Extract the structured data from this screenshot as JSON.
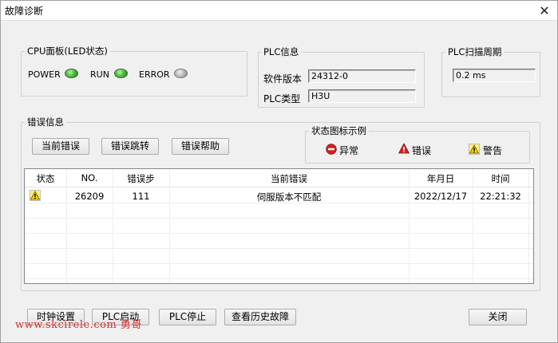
{
  "window": {
    "title": "故障诊断",
    "close_glyph": "✕"
  },
  "cpu_panel": {
    "title": "CPU面板(LED状态)",
    "leds": [
      {
        "label": "POWER",
        "state": "on"
      },
      {
        "label": "RUN",
        "state": "on"
      },
      {
        "label": "ERROR",
        "state": "off"
      }
    ]
  },
  "plc_info": {
    "title": "PLC信息",
    "software_version_label": "软件版本",
    "software_version": "24312-0",
    "plc_type_label": "PLC类型",
    "plc_type": "H3U"
  },
  "scan_cycle": {
    "title": "PLC扫描周期",
    "value": "0.2 ms"
  },
  "error_info": {
    "title": "错误信息",
    "buttons": {
      "current": "当前错误",
      "jump": "错误跳转",
      "help": "错误帮助"
    }
  },
  "legend": {
    "title": "状态图标示例",
    "items": [
      {
        "label": "异常",
        "icon": "abnormal-icon"
      },
      {
        "label": "错误",
        "icon": "error-icon"
      },
      {
        "label": "警告",
        "icon": "warning-icon"
      }
    ]
  },
  "table": {
    "columns": [
      "状态",
      "NO.",
      "错误步",
      "当前错误",
      "年月日",
      "时间"
    ],
    "rows": [
      {
        "status_icon": "warning-icon",
        "no": "26209",
        "step": "111",
        "error": "伺服版本不匹配",
        "date": "2022/12/17",
        "time": "22:21:32"
      }
    ]
  },
  "footer": {
    "buttons": {
      "clock": "时钟设置",
      "plc_start": "PLC启动",
      "plc_stop": "PLC停止",
      "history": "查看历史故障",
      "close": "关闭"
    }
  },
  "watermark": "www.skcirele.com 勇哥",
  "colors": {
    "led_on": "#4fbf3f",
    "led_off": "#b8b8b8",
    "warning": "#f5d000",
    "error": "#d62020",
    "watermark": "#d03030"
  }
}
